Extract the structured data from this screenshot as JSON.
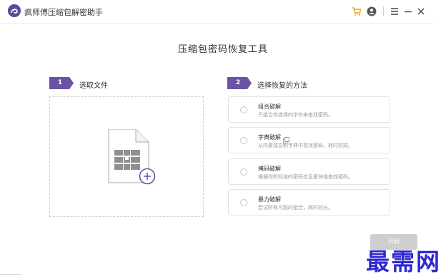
{
  "app": {
    "title": "疯师傅压缩包解密助手",
    "icons": [
      "cart-icon",
      "user-icon",
      "menu-icon",
      "minimize-icon",
      "close-icon"
    ],
    "accent_color": "#6a53a6",
    "cart_color": "#f0a020"
  },
  "page": {
    "title": "压缩包密码恢复工具"
  },
  "steps": [
    {
      "number": "1",
      "label": "选取文件"
    },
    {
      "number": "2",
      "label": "选择恢复的方法"
    }
  ],
  "methods": [
    {
      "title": "组合破解",
      "description": "只组合你选择的字符来查找密码。"
    },
    {
      "title": "字典破解",
      "description": "从内置或自制字典中查找密码，耗时较短。"
    },
    {
      "title": "掩码破解",
      "description": "根据你所知道的密码信息更快地查找密码。"
    },
    {
      "title": "暴力破解",
      "description": "尝试所有可能的组合，耗时较长。"
    }
  ],
  "actions": {
    "start_label": "开始"
  },
  "watermark": {
    "text": "最需网"
  }
}
